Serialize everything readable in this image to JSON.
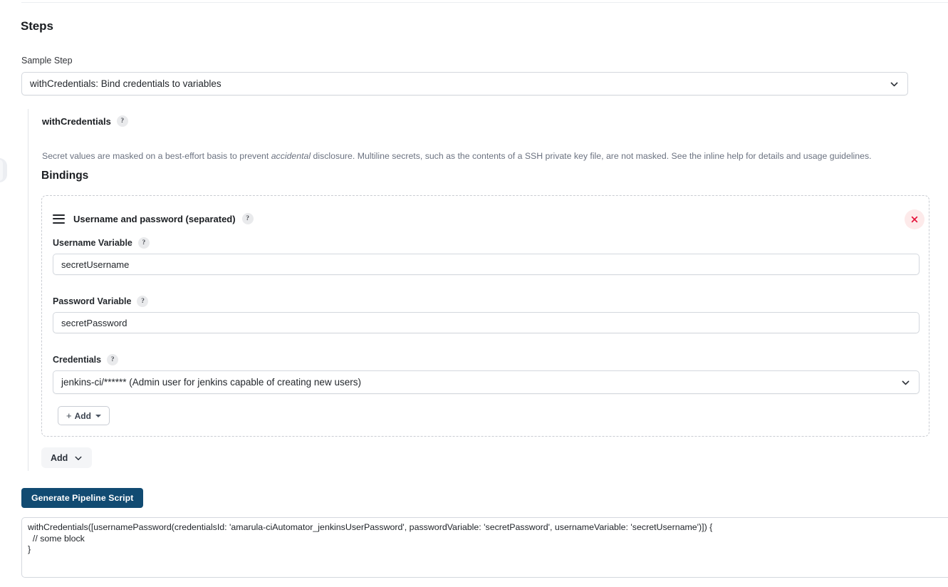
{
  "section": {
    "title": "Steps"
  },
  "sample_step": {
    "label": "Sample Step",
    "selected": "withCredentials: Bind credentials to variables"
  },
  "step": {
    "name": "withCredentials",
    "help_glyph": "?",
    "description_prefix": "Secret values are masked on a best-effort basis to prevent ",
    "description_emphasis": "accidental",
    "description_suffix": " disclosure. Multiline secrets, such as the contents of a SSH private key file, are not masked. See the inline help for details and usage guidelines."
  },
  "bindings": {
    "title": "Bindings",
    "card": {
      "type_title": "Username and password (separated)",
      "delete_label": "Delete",
      "fields": [
        {
          "label": "Username Variable",
          "value": "secretUsername",
          "placeholder": ""
        },
        {
          "label": "Password Variable",
          "value": "secretPassword",
          "placeholder": ""
        },
        {
          "label": "Credentials",
          "value": "jenkins-ci/****** (Admin user for jenkins capable of creating new users)",
          "placeholder": ""
        }
      ],
      "add_label": "Add",
      "add_plus": "+"
    },
    "add_label": "Add"
  },
  "actions": {
    "generate_label": "Generate Pipeline Script"
  },
  "generated_script": {
    "value": "withCredentials([usernamePassword(credentialsId: 'amarula-ciAutomator_jenkinsUserPassword', passwordVariable: 'secretPassword', usernameVariable: 'secretUsername')]) {\n  // some block\n}"
  },
  "colors": {
    "accent": "#114b72",
    "danger": "#e5133b",
    "danger_bg": "#fdeaea",
    "border": "#d4d8de",
    "muted_text": "#6b7280"
  }
}
